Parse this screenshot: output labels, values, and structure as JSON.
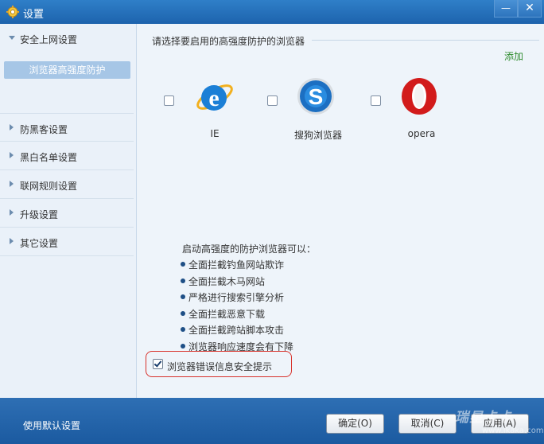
{
  "window": {
    "title": "设置"
  },
  "titlebar": {
    "minimize_glyph": "—",
    "close_glyph": "✕"
  },
  "sidebar": {
    "items": [
      {
        "label": "安全上网设置",
        "expanded": true
      },
      {
        "label": "防黑客设置"
      },
      {
        "label": "黑白名单设置"
      },
      {
        "label": "联网规则设置"
      },
      {
        "label": "升级设置"
      },
      {
        "label": "其它设置"
      }
    ],
    "sub_item": {
      "label": "浏览器高强度防护"
    }
  },
  "main": {
    "header": "请选择要启用的高强度防护的浏览器",
    "add_link": "添加",
    "browsers": [
      {
        "name": "IE",
        "icon": "ie-icon",
        "checked": false
      },
      {
        "name": "搜狗浏览器",
        "icon": "sogou-browser-icon",
        "checked": false
      },
      {
        "name": "opera",
        "icon": "opera-icon",
        "checked": false
      }
    ],
    "info_title": "启动高强度的防护浏览器可以：",
    "bullets": [
      "全面拦截钓鱼网站欺诈",
      "全面拦截木马网站",
      "严格进行搜索引擎分析",
      "全面拦截恶意下载",
      "全面拦截跨站脚本攻击",
      "浏览器响应速度会有下降"
    ],
    "notice": {
      "label": "浏览器错误信息安全提示",
      "checked": true
    }
  },
  "footer": {
    "default_label": "使用默认设置",
    "ok_label": "确定(O)",
    "cancel_label": "取消(C)",
    "apply_label": "应用(A)"
  },
  "watermark": {
    "text": "瑞星卡卡",
    "url": "www.ikaka.com"
  },
  "colors": {
    "titlebar": "#1d63ad",
    "sidebar_selected": "#a6c6e6",
    "add_link": "#2f8c2f",
    "notice_border": "#d8322b",
    "footer": "#1b5aa0"
  }
}
